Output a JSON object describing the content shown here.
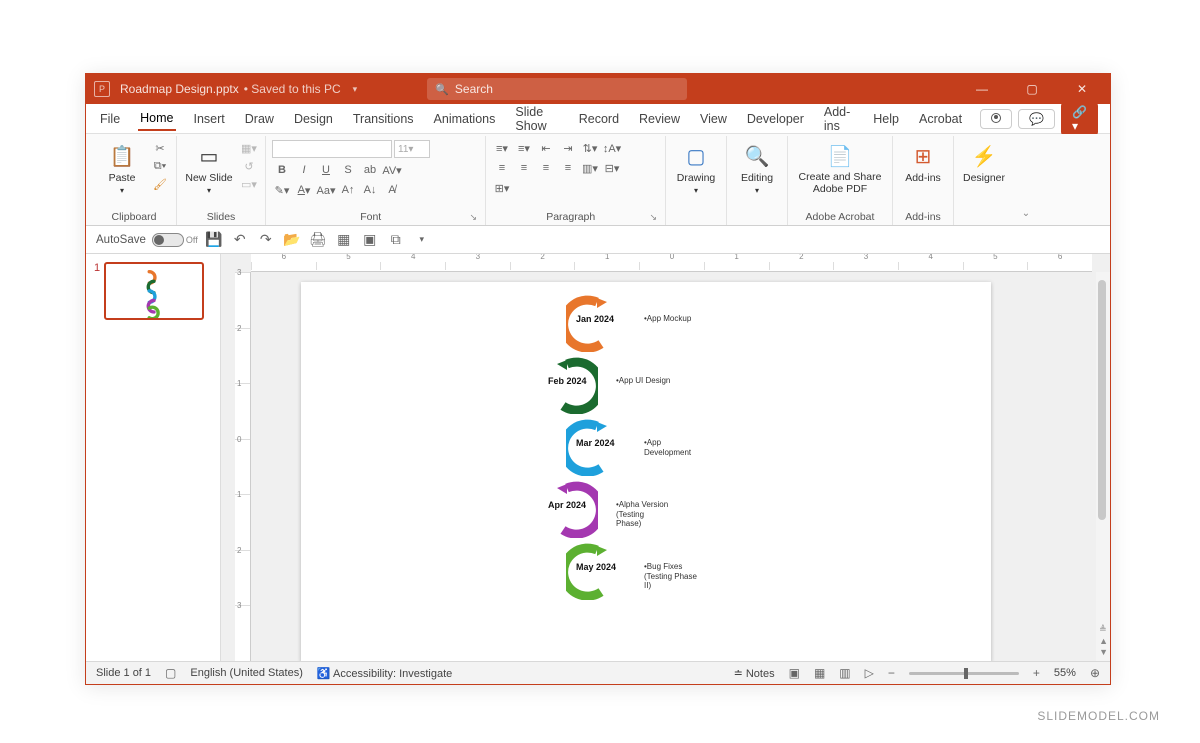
{
  "titlebar": {
    "filename": "Roadmap Design.pptx",
    "save_state": "Saved to this PC",
    "search_placeholder": "Search"
  },
  "tabs": [
    "File",
    "Home",
    "Insert",
    "Draw",
    "Design",
    "Transitions",
    "Animations",
    "Slide Show",
    "Record",
    "Review",
    "View",
    "Developer",
    "Add-ins",
    "Help",
    "Acrobat"
  ],
  "active_tab": "Home",
  "ribbon": {
    "paste": "Paste",
    "new_slide": "New Slide",
    "drawing": "Drawing",
    "editing": "Editing",
    "adobe": "Create and Share Adobe PDF",
    "addins": "Add-ins",
    "designer": "Designer",
    "group_clipboard": "Clipboard",
    "group_slides": "Slides",
    "group_font": "Font",
    "group_paragraph": "Paragraph",
    "group_adobe": "Adobe Acrobat",
    "group_addins": "Add-ins",
    "fontsize_ph": "11"
  },
  "qat": {
    "autosave_label": "AutoSave",
    "autosave_state": "Off"
  },
  "status": {
    "slide_counter": "Slide 1 of 1",
    "language": "English (United States)",
    "accessibility": "Accessibility: Investigate",
    "notes": "Notes",
    "zoom": "55%"
  },
  "roadmap": [
    {
      "month": "Jan 2024",
      "desc": "•App Mockup",
      "color": "#e8762c"
    },
    {
      "month": "Feb 2024",
      "desc": "•App UI Design",
      "color": "#1b6b2f"
    },
    {
      "month": "Mar 2024",
      "desc": "•App\nDevelopment",
      "color": "#1ea0dc"
    },
    {
      "month": "Apr 2024",
      "desc": "•Alpha Version\n(Testing\nPhase)",
      "color": "#a438b0"
    },
    {
      "month": "May 2024",
      "desc": "•Bug Fixes\n(Testing Phase\nII)",
      "color": "#5cb031"
    }
  ],
  "ruler_h": [
    "6",
    "5",
    "4",
    "3",
    "2",
    "1",
    "0",
    "1",
    "2",
    "3",
    "4",
    "5",
    "6"
  ],
  "ruler_v": [
    "3",
    "2",
    "1",
    "0",
    "1",
    "2",
    "3"
  ],
  "thumbnail_number": "1",
  "watermark": "SLIDEMODEL.COM"
}
